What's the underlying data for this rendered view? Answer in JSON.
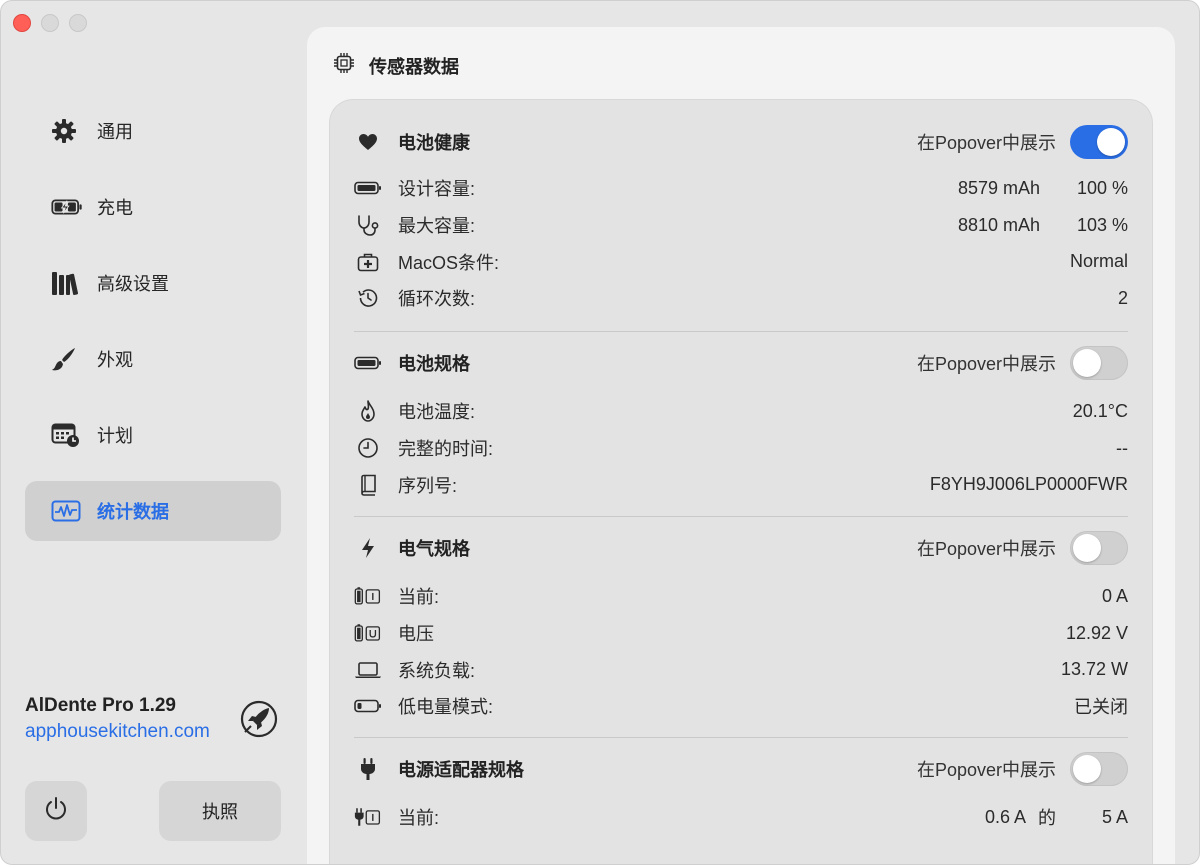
{
  "sidebar": {
    "items": [
      {
        "label": "通用",
        "icon": "gear-icon"
      },
      {
        "label": "充电",
        "icon": "battery-charging-icon"
      },
      {
        "label": "高级设置",
        "icon": "books-icon"
      },
      {
        "label": "外观",
        "icon": "paintbrush-icon"
      },
      {
        "label": "计划",
        "icon": "calendar-clock-icon"
      },
      {
        "label": "统计数据",
        "icon": "waveform-chart-icon",
        "active": true
      }
    ],
    "app_name": "AlDente Pro 1.29",
    "app_link": "apphousekitchen.com",
    "license_button": "执照"
  },
  "header": {
    "title": "传感器数据"
  },
  "sections": {
    "health": {
      "title": "电池健康",
      "show_label": "在Popover中展示",
      "toggle_on": true,
      "rows": [
        {
          "label": "设计容量:",
          "value1": "8579 mAh",
          "value2": "100 %"
        },
        {
          "label": "最大容量:",
          "value1": "8810 mAh",
          "value2": "103 %"
        },
        {
          "label": "MacOS条件:",
          "value": "Normal"
        },
        {
          "label": "循环次数:",
          "value": "2"
        }
      ]
    },
    "spec": {
      "title": "电池规格",
      "show_label": "在Popover中展示",
      "toggle_on": false,
      "rows": [
        {
          "label": "电池温度:",
          "value": "20.1°C"
        },
        {
          "label": "完整的时间:",
          "value": "--"
        },
        {
          "label": "序列号:",
          "value": "F8YH9J006LP0000FWR"
        }
      ]
    },
    "electric": {
      "title": "电气规格",
      "show_label": "在Popover中展示",
      "toggle_on": false,
      "rows": [
        {
          "label": "当前:",
          "value": "0 A"
        },
        {
          "label": "电压",
          "value": "12.92 V"
        },
        {
          "label": "系统负载:",
          "value": "13.72 W"
        },
        {
          "label": "低电量模式:",
          "value": "已关闭"
        }
      ]
    },
    "adapter": {
      "title": "电源适配器规格",
      "show_label": "在Popover中展示",
      "toggle_on": false,
      "rows": [
        {
          "label": "当前:",
          "value1": "0.6 A",
          "of": "的",
          "value2": "5 A"
        }
      ]
    }
  },
  "colors": {
    "accent": "#2a6ee6",
    "close": "#ff5f57"
  }
}
